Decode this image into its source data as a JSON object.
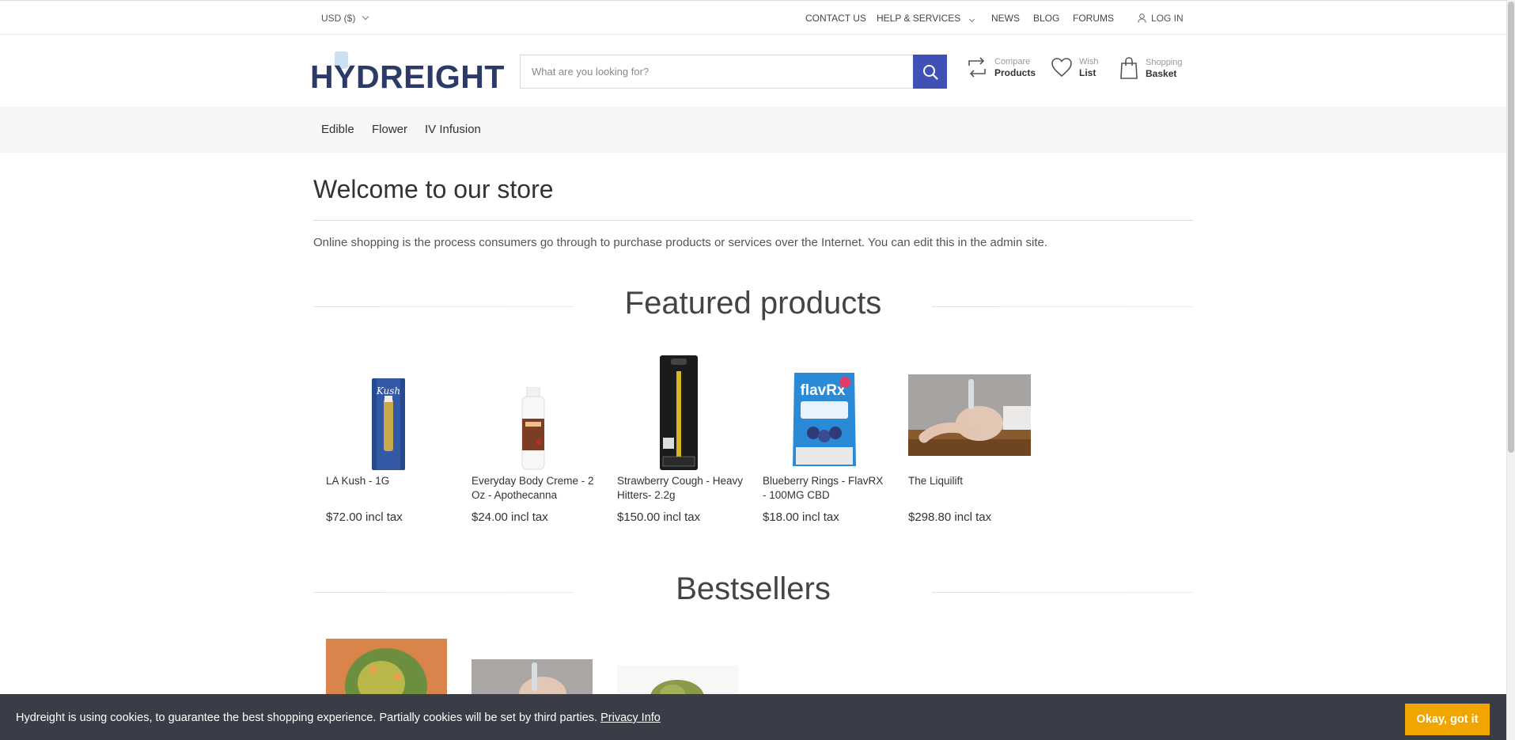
{
  "topbar": {
    "currency": "USD ($)",
    "links": {
      "contact": "CONTACT US",
      "help": "HELP & SERVICES",
      "news": "NEWS",
      "blog": "BLOG",
      "forums": "FORUMS",
      "login": "LOG IN"
    }
  },
  "header": {
    "logo_text": "HYDREIGHT",
    "search": {
      "placeholder": "What are you looking for?",
      "value": ""
    },
    "compare": {
      "small": "Compare",
      "big": "Products"
    },
    "wishlist": {
      "small": "Wish",
      "big": "List"
    },
    "basket": {
      "small": "Shopping",
      "big": "Basket"
    }
  },
  "nav": {
    "items": [
      "Edible",
      "Flower",
      "IV Infusion"
    ]
  },
  "main": {
    "welcome_title": "Welcome to our store",
    "intro": "Online shopping is the process consumers go through to purchase products or services over the Internet. You can edit this in the admin site.",
    "featured_title": "Featured products",
    "bestsellers_title": "Bestsellers",
    "featured": [
      {
        "name": "LA Kush - 1G",
        "price": "$72.00 incl tax"
      },
      {
        "name": "Everyday Body Creme - 2 Oz - Apothecanna",
        "price": "$24.00 incl tax"
      },
      {
        "name": "Strawberry Cough - Heavy Hitters- 2.2g",
        "price": "$150.00 incl tax"
      },
      {
        "name": "Blueberry Rings - FlavRX - 100MG CBD",
        "price": "$18.00 incl tax"
      },
      {
        "name": "The Liquilift",
        "price": "$298.80 incl tax"
      }
    ]
  },
  "cookie": {
    "text": "Hydreight is using cookies, to guarantee the best shopping experience. Partially cookies will be set by third parties.",
    "link": "Privacy Info",
    "button": "Okay, got it"
  },
  "colors": {
    "accent": "#3f51b5",
    "cookie_bg": "#383d47",
    "cookie_button": "#f0a500",
    "logo": "#2b3a67"
  },
  "icons": [
    "user-icon",
    "search-icon",
    "compare-icon",
    "heart-icon",
    "bag-icon",
    "chevron-down-icon"
  ]
}
